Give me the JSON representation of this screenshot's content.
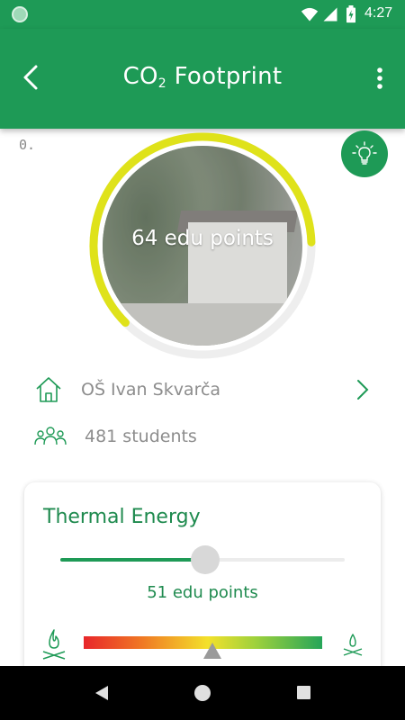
{
  "status_bar": {
    "time": "4:27"
  },
  "header": {
    "title_prefix": "CO",
    "title_sub": "2",
    "title_suffix": " Footprint"
  },
  "gauge": {
    "min_label": "0.",
    "points_text": "64 edu points",
    "progress_fraction": 0.62,
    "colors": {
      "progress": "#dfe21a",
      "track": "#eeeeee"
    }
  },
  "school": {
    "name": "OŠ Ivan Skvarča"
  },
  "students": {
    "count_text": "481 students"
  },
  "thermal_card": {
    "title": "Thermal Energy",
    "slider_fraction": 0.51,
    "points_text": "51 edu points",
    "scale_marker_fraction": 0.54
  },
  "icons": {
    "back": "arrow-left-icon",
    "more": "more-vert-icon",
    "bulb": "lightbulb-icon",
    "house": "house-icon",
    "chevron": "chevron-right-icon",
    "people": "group-icon",
    "fire_high": "campfire-icon",
    "fire_low": "small-campfire-icon"
  },
  "colors": {
    "primary": "#1e9a56",
    "text_green": "#1e8a4e"
  }
}
